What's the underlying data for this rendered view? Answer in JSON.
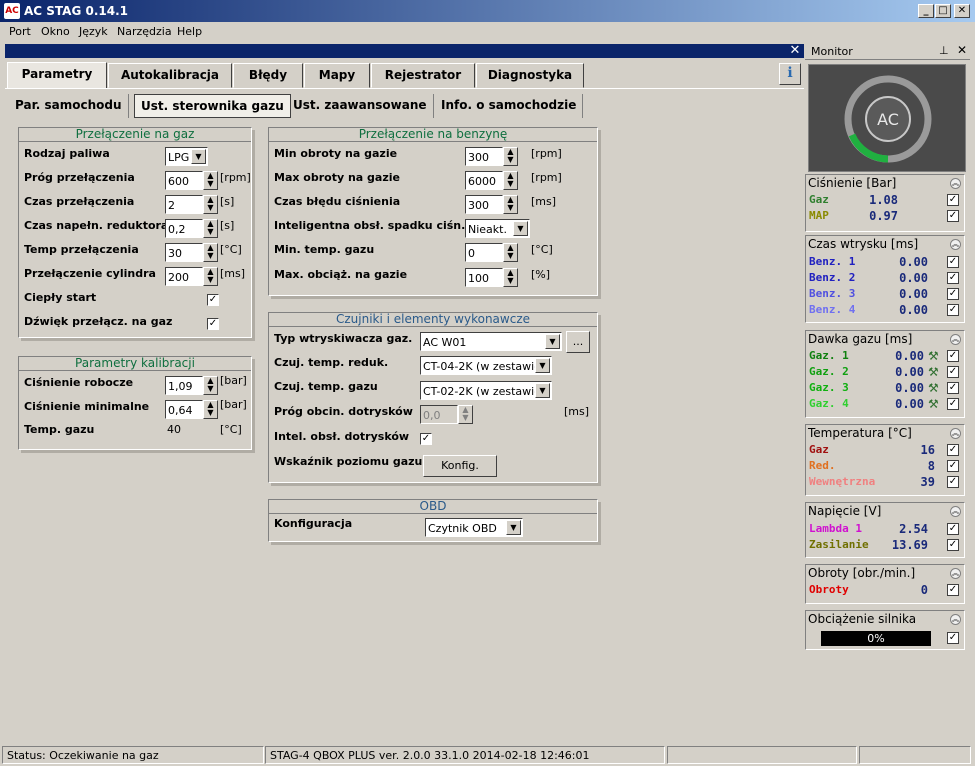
{
  "window": {
    "title": "AC STAG 0.14.1",
    "minimize": "_",
    "maximize": "□",
    "close": "✕"
  },
  "menu": [
    "Port",
    "Okno",
    "Język",
    "Narzędzia",
    "Help"
  ],
  "tabs": [
    "Parametry",
    "Autokalibracja",
    "Błędy",
    "Mapy",
    "Rejestrator",
    "Diagnostyka"
  ],
  "subtabs": [
    "Par. samochodu",
    "Ust. sterownika gazu",
    "Ust. zaawansowane",
    "Info. o samochodzie"
  ],
  "switch_gas": {
    "title": "Przełączenie na gaz",
    "fuel_type_label": "Rodzaj paliwa",
    "fuel_type": "LPG",
    "threshold_label": "Próg przełączenia",
    "threshold": "600",
    "threshold_unit": "[rpm]",
    "time_label": "Czas przełączenia",
    "time": "2",
    "time_unit": "[s]",
    "reducer_label": "Czas napełn. reduktora",
    "reducer": "0,2",
    "reducer_unit": "[s]",
    "temp_label": "Temp przełączenia",
    "temp": "30",
    "temp_unit": "[°C]",
    "cyl_label": "Przełączenie cylindra",
    "cyl": "200",
    "cyl_unit": "[ms]",
    "warm_label": "Ciepły start",
    "sound_label": "Dźwięk przełącz. na gaz"
  },
  "calib": {
    "title": "Parametry kalibracji",
    "work_label": "Ciśnienie robocze",
    "work": "1,09",
    "work_unit": "[bar]",
    "min_label": "Ciśnienie minimalne",
    "min": "0,64",
    "min_unit": "[bar]",
    "gas_temp_label": "Temp. gazu",
    "gas_temp": "40",
    "gas_temp_unit": "[°C]"
  },
  "switch_petrol": {
    "title": "Przełączenie na benzynę",
    "minrpm_label": "Min obroty na gazie",
    "minrpm": "300",
    "minrpm_unit": "[rpm]",
    "maxrpm_label": "Max obroty na gazie",
    "maxrpm": "6000",
    "maxrpm_unit": "[rpm]",
    "perr_label": "Czas błędu ciśnienia",
    "perr": "300",
    "perr_unit": "[ms]",
    "smart_label": "Inteligentna obsł. spadku ciśn.",
    "smart": "Nieakt.",
    "mintemp_label": "Min. temp. gazu",
    "mintemp": "0",
    "mintemp_unit": "[°C]",
    "maxload_label": "Max. obciąż. na gazie",
    "maxload": "100",
    "maxload_unit": "[%]"
  },
  "sensors": {
    "title": "Czujniki i elementy wykonawcze",
    "inj_label": "Typ wtryskiwacza gaz.",
    "inj": "AC W01",
    "more": "...",
    "red_label": "Czuj. temp. reduk.",
    "red": "CT-04-2K (w zestawie)",
    "gas_label": "Czuj. temp. gazu",
    "gas": "CT-02-2K (w zestawie)",
    "cut_label": "Próg obcin. dotrysków",
    "cut": "0,0",
    "cut_unit": "[ms]",
    "intel_label": "Intel. obsł. dotrysków",
    "level_label": "Wskaźnik poziomu gazu",
    "level_btn": "Konfig."
  },
  "obd": {
    "title": "OBD",
    "config_label": "Konfiguracja",
    "config": "Czytnik OBD"
  },
  "monitor": {
    "title": "Monitor",
    "pressure": {
      "title": "Ciśnienie [Bar]",
      "rows": [
        {
          "label": "Gaz",
          "value": "1.08",
          "color": "#2f7f2f"
        },
        {
          "label": "MAP",
          "value": "0.97",
          "color": "#8a8a00"
        }
      ]
    },
    "injection": {
      "title": "Czas wtrysku [ms]",
      "rows": [
        {
          "label": "Benz. 1",
          "value": "0.00",
          "color": "#2020c0"
        },
        {
          "label": "Benz. 2",
          "value": "0.00",
          "color": "#2020c0"
        },
        {
          "label": "Benz. 3",
          "value": "0.00",
          "color": "#5050e0"
        },
        {
          "label": "Benz. 4",
          "value": "0.00",
          "color": "#7070f0"
        }
      ]
    },
    "dose": {
      "title": "Dawka gazu [ms]",
      "rows": [
        {
          "label": "Gaz. 1",
          "value": "0.00",
          "color": "#108010"
        },
        {
          "label": "Gaz. 2",
          "value": "0.00",
          "color": "#10a010"
        },
        {
          "label": "Gaz. 3",
          "value": "0.00",
          "color": "#10b010"
        },
        {
          "label": "Gaz. 4",
          "value": "0.00",
          "color": "#30d030"
        }
      ]
    },
    "temperature": {
      "title": "Temperatura [°C]",
      "rows": [
        {
          "label": "Gaz",
          "value": "16",
          "color": "#a01010"
        },
        {
          "label": "Red.",
          "value": "8",
          "color": "#e07020"
        },
        {
          "label": "Wewnętrzna",
          "value": "39",
          "color": "#f08080"
        }
      ]
    },
    "voltage": {
      "title": "Napięcie [V]",
      "rows": [
        {
          "label": "Lambda 1",
          "value": "2.54",
          "color": "#d010d0"
        },
        {
          "label": "Zasilanie",
          "value": "13.69",
          "color": "#707000"
        }
      ]
    },
    "rpm": {
      "title": "Obroty [obr./min.]",
      "rows": [
        {
          "label": "Obroty",
          "value": "0",
          "color": "#e00000"
        }
      ]
    },
    "load": {
      "title": "Obciążenie silnika",
      "value": "0%",
      "fraction": 0
    }
  },
  "status": {
    "text": "Status: Oczekiwanie na gaz",
    "device": "STAG-4 QBOX PLUS  ver. 2.0.0  33.1.0  2014-02-18 12:46:01"
  }
}
